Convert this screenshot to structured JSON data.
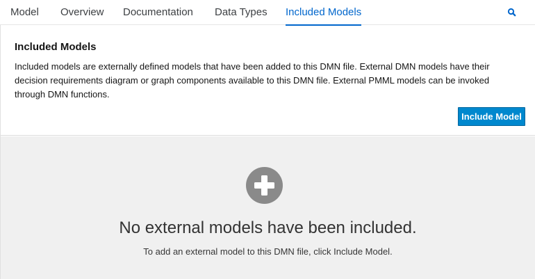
{
  "tabs": [
    {
      "label": "Model"
    },
    {
      "label": "Overview"
    },
    {
      "label": "Documentation"
    },
    {
      "label": "Data Types"
    },
    {
      "label": "Included Models",
      "active": true
    }
  ],
  "search": {
    "icon": "search-icon",
    "color": "#0066cc"
  },
  "section": {
    "title": "Included Models",
    "description": "Included models are externally defined models that have been added to this DMN file. External DMN models have their decision requirements diagram or graph components available to this DMN file. External PMML models can be invoked through DMN functions.",
    "include_button_label": "Include Model"
  },
  "empty_state": {
    "icon": "plus-circle-icon",
    "title": "No external models have been included.",
    "subtitle": "To add an external model to this DMN file, click Include Model."
  },
  "colors": {
    "accent": "#0066cc",
    "primary_button": "#0088ce",
    "empty_background": "#f0f0f0",
    "empty_icon": "#8a8a8a"
  }
}
